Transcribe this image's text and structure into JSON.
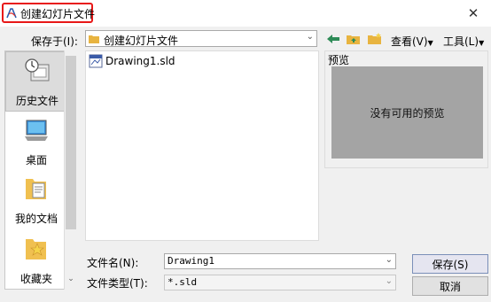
{
  "window": {
    "title": "创建幻灯片文件",
    "close_glyph": "✕"
  },
  "save_in": {
    "label": "保存于(I):",
    "value": "创建幻灯片文件"
  },
  "toolbar": {
    "view_label": "查看(V)",
    "tools_label": "工具(L)"
  },
  "places": [
    {
      "label": "历史文件",
      "icon": "history-icon",
      "selected": true
    },
    {
      "label": "桌面",
      "icon": "desktop-icon",
      "selected": false
    },
    {
      "label": "我的文档",
      "icon": "documents-icon",
      "selected": false
    },
    {
      "label": "收藏夹",
      "icon": "favorites-icon",
      "selected": false
    }
  ],
  "files": [
    {
      "name": "Drawing1.sld",
      "icon": "sld-file-icon"
    }
  ],
  "preview": {
    "label": "预览",
    "empty_text": "没有可用的预览"
  },
  "form": {
    "filename_label": "文件名(N):",
    "filename_value": "Drawing1",
    "filetype_label": "文件类型(T):",
    "filetype_value": "*.sld"
  },
  "buttons": {
    "save": "保存(S)",
    "cancel": "取消"
  },
  "colors": {
    "highlight_border": "#e81818",
    "preview_bg": "#a4a4a4",
    "back_arrow": "#2e8b57",
    "folder": "#e8b440"
  }
}
